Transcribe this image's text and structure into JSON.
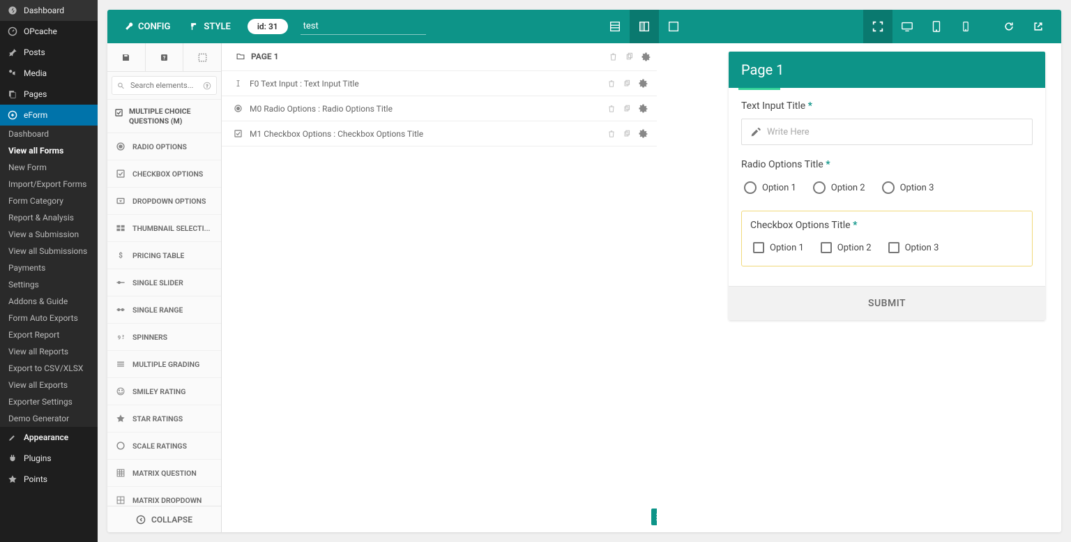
{
  "adminMenu": {
    "top": [
      {
        "label": "Dashboard",
        "icon": "dashboard"
      },
      {
        "label": "OPcache",
        "icon": "gauge"
      },
      {
        "label": "Posts",
        "icon": "pin"
      },
      {
        "label": "Media",
        "icon": "media"
      },
      {
        "label": "Pages",
        "icon": "pages"
      },
      {
        "label": "eForm",
        "icon": "eform",
        "active": true
      }
    ],
    "sub": [
      {
        "label": "Dashboard"
      },
      {
        "label": "View all Forms",
        "highlight": true
      },
      {
        "label": "New Form"
      },
      {
        "label": "Import/Export Forms"
      },
      {
        "label": "Form Category"
      },
      {
        "label": "Report & Analysis"
      },
      {
        "label": "View a Submission"
      },
      {
        "label": "View all Submissions"
      },
      {
        "label": "Payments"
      },
      {
        "label": "Settings"
      },
      {
        "label": "Addons & Guide"
      },
      {
        "label": "Form Auto Exports"
      },
      {
        "label": "Export Report"
      },
      {
        "label": "View all Reports"
      },
      {
        "label": "Export to CSV/XLSX"
      },
      {
        "label": "View all Exports"
      },
      {
        "label": "Exporter Settings"
      },
      {
        "label": "Demo Generator"
      }
    ],
    "bottom": [
      {
        "label": "Appearance",
        "icon": "brush",
        "bold": true
      },
      {
        "label": "Plugins",
        "icon": "plug"
      },
      {
        "label": "Points",
        "icon": "star"
      }
    ]
  },
  "toolbar": {
    "config": "CONFIG",
    "style": "STYLE",
    "idPill": "id: 31",
    "formName": "test"
  },
  "elementsPanel": {
    "searchPlaceholder": "Search elements...",
    "groupTitle": "MULTIPLE CHOICE QUESTIONS (M)",
    "items": [
      {
        "icon": "radio",
        "label": "RADIO OPTIONS"
      },
      {
        "icon": "checkbox",
        "label": "CHECKBOX OPTIONS"
      },
      {
        "icon": "dropdown",
        "label": "DROPDOWN OPTIONS"
      },
      {
        "icon": "thumbnail",
        "label": "THUMBNAIL SELECTI..."
      },
      {
        "icon": "dollar",
        "label": "PRICING TABLE"
      },
      {
        "icon": "slider",
        "label": "SINGLE SLIDER"
      },
      {
        "icon": "range",
        "label": "SINGLE RANGE"
      },
      {
        "icon": "spinner",
        "label": "SPINNERS"
      },
      {
        "icon": "grading",
        "label": "MULTIPLE GRADING"
      },
      {
        "icon": "smiley",
        "label": "SMILEY RATING"
      },
      {
        "icon": "star",
        "label": "STAR RATINGS"
      },
      {
        "icon": "scale",
        "label": "SCALE RATINGS"
      },
      {
        "icon": "matrix",
        "label": "MATRIX QUESTION"
      },
      {
        "icon": "matrixdd",
        "label": "MATRIX DROPDOWN"
      }
    ],
    "collapse": "COLLAPSE"
  },
  "canvas": {
    "pageTab": "PAGE 1",
    "fields": [
      {
        "icon": "textinput",
        "label": "F0 Text Input : Text Input Title"
      },
      {
        "icon": "radio",
        "label": "M0 Radio Options : Radio Options Title"
      },
      {
        "icon": "checkbox",
        "label": "M1 Checkbox Options : Checkbox Options Title"
      }
    ]
  },
  "preview": {
    "headerTitle": "Page 1",
    "textInput": {
      "label": "Text Input Title",
      "placeholder": "Write Here"
    },
    "radio": {
      "label": "Radio Options Title",
      "options": [
        "Option 1",
        "Option 2",
        "Option 3"
      ]
    },
    "checkbox": {
      "label": "Checkbox Options Title",
      "options": [
        "Option 1",
        "Option 2",
        "Option 3"
      ]
    },
    "submit": "SUBMIT"
  }
}
